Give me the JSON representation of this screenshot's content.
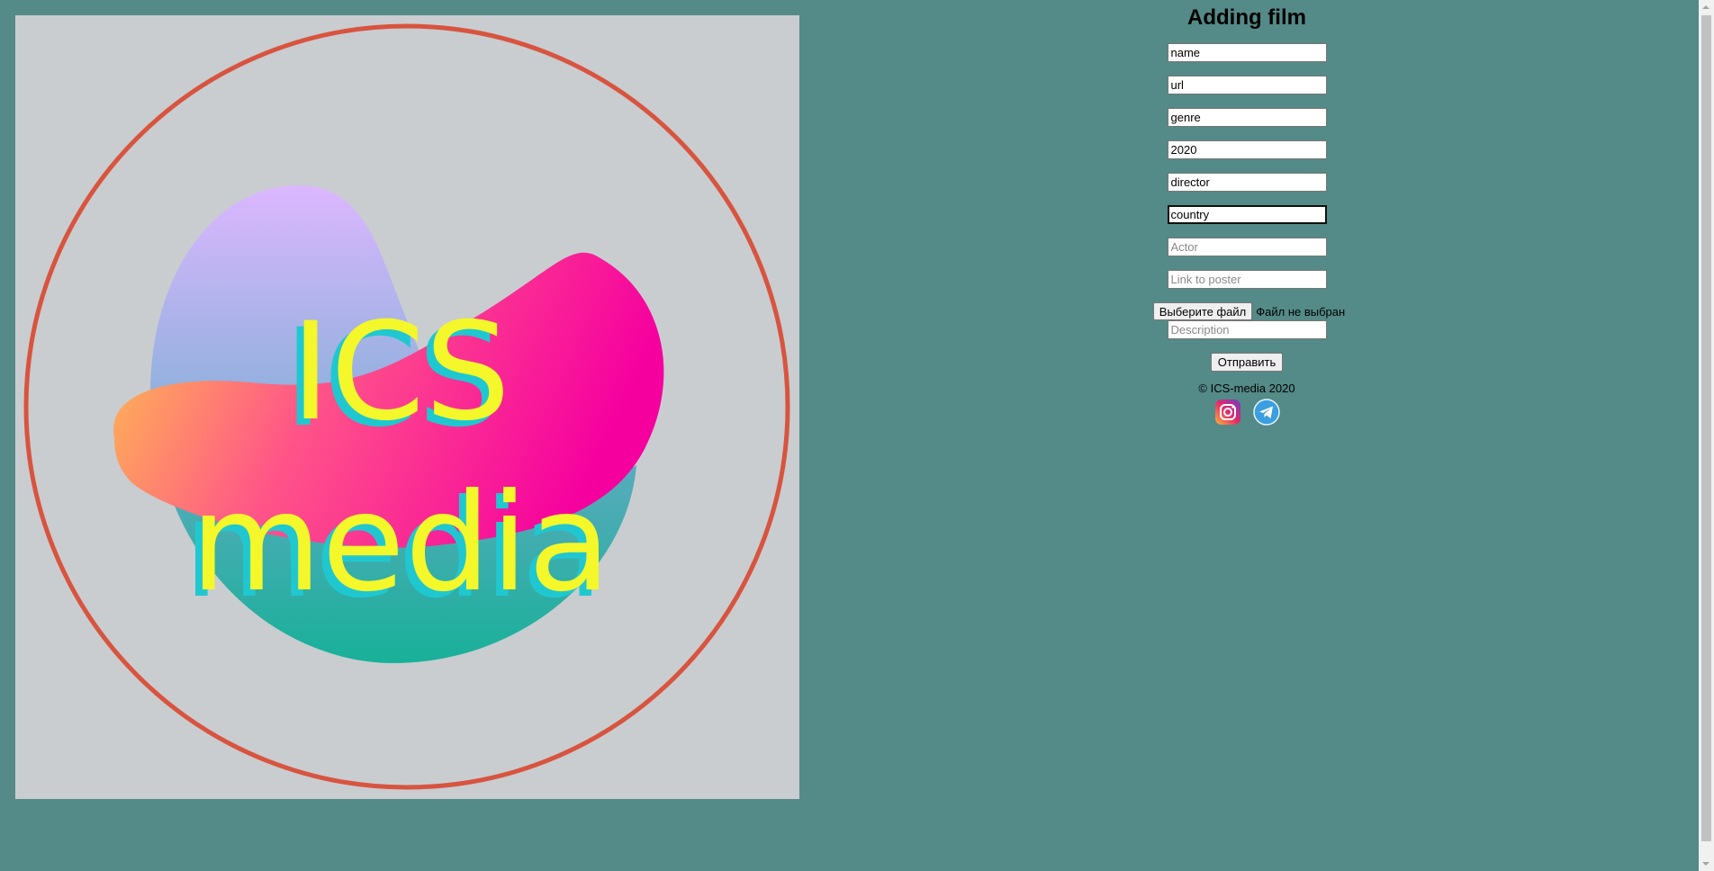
{
  "logo": {
    "line1": "ICS",
    "line2": "media",
    "colors": {
      "background": "#c9cdd0",
      "ring": "#d8543f",
      "text_yellow": "#f4f72a",
      "text_cyan": "#1fc8d0",
      "blob_pink": "#f5009a",
      "blob_orange": "#ffc24a",
      "blob_lilac": "#d9b8ff",
      "blob_teal": "#1fb39a"
    }
  },
  "form": {
    "title": "Adding film",
    "fields": [
      {
        "value": "name",
        "placeholder": ""
      },
      {
        "value": "url",
        "placeholder": ""
      },
      {
        "value": "genre",
        "placeholder": ""
      },
      {
        "value": "2020",
        "placeholder": ""
      },
      {
        "value": "director",
        "placeholder": ""
      },
      {
        "value": "country",
        "placeholder": "",
        "focused": true
      },
      {
        "value": "",
        "placeholder": "Actor"
      },
      {
        "value": "",
        "placeholder": "Link to poster"
      }
    ],
    "file_button_label": "Выберите файл",
    "file_status": "Файл не выбран",
    "description_placeholder": "Description",
    "submit_label": "Отправить"
  },
  "footer": {
    "copyright": "© ICS-media 2020",
    "social": [
      "instagram-icon",
      "telegram-icon"
    ]
  },
  "colors": {
    "page_background": "#548a87"
  }
}
